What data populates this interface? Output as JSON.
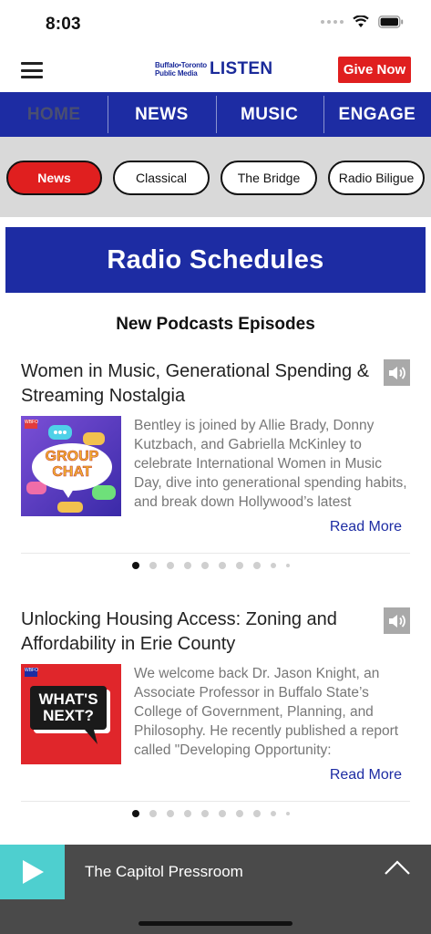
{
  "status_bar": {
    "time": "8:03"
  },
  "header": {
    "logo_line1": "Buffalo•Toronto",
    "logo_line2": "Public Media",
    "logo_main": "LISTEN",
    "give_now": "Give Now"
  },
  "nav": {
    "items": [
      "HOME",
      "NEWS",
      "MUSIC",
      "ENGAGE"
    ],
    "active": "HOME"
  },
  "stations": {
    "items": [
      "News",
      "Classical",
      "The Bridge",
      "Radio Biligue"
    ],
    "active": "News"
  },
  "banner": {
    "label": "Radio Schedules"
  },
  "podcasts": {
    "title": "New Podcasts Episodes",
    "episodes": [
      {
        "title": "Women in Music, Generational Spending & Streaming Nostalgia",
        "description": "Bentley is joined by Allie Brady, Donny Kutzbach, and Gabriella McKinley to celebrate International Women in Music Day, dive into generational spending habits, and break down Hollywood’s latest",
        "read_more": "Read More",
        "thumb_text_1": "GROUP",
        "thumb_text_2": "CHAT",
        "thumb_badge": "WBFO"
      },
      {
        "title": "Unlocking Housing Access: Zoning and Affordability in Erie County",
        "description": "We welcome back Dr. Jason Knight, an Associate Professor in Buffalo State’s College of Government, Planning, and Philosophy. He recently published a report called \"Developing Opportunity:",
        "read_more": "Read More",
        "thumb_text_1": "WHAT'S",
        "thumb_text_2": "NEXT?",
        "thumb_badge": "WBFO"
      }
    ]
  },
  "player": {
    "title": "The Capitol Pressroom"
  },
  "colors": {
    "brand_blue": "#1d2ca3",
    "accent_red": "#e01f1f",
    "player_teal": "#4ecfcf",
    "player_bg": "#4a4a4a"
  }
}
